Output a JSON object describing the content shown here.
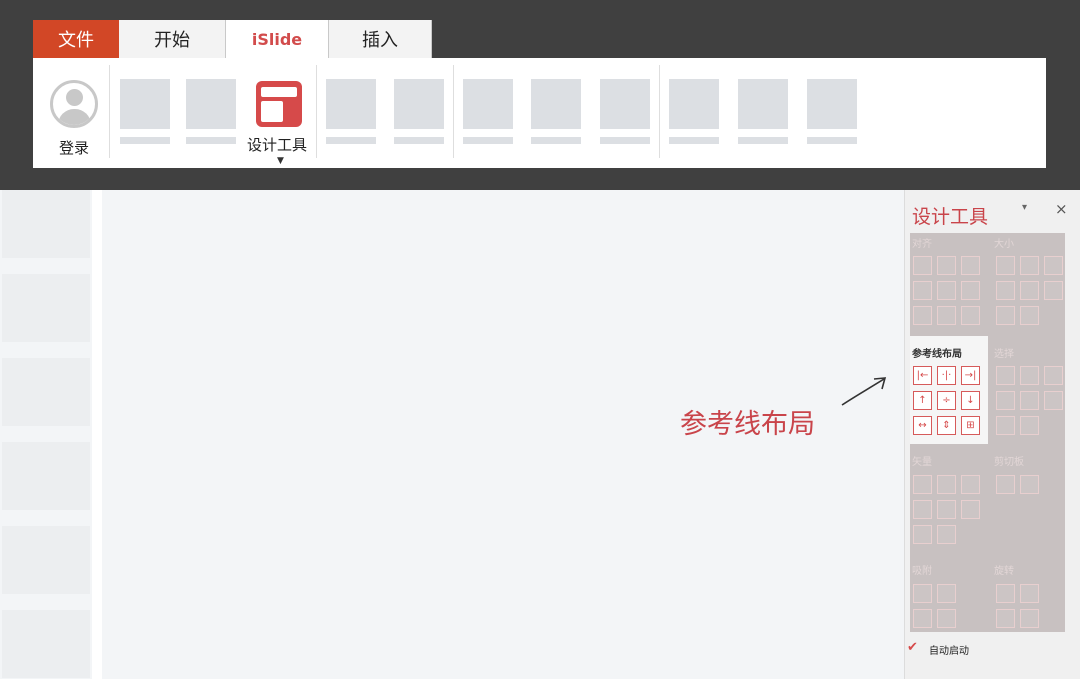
{
  "tabs": [
    {
      "label": "文件"
    },
    {
      "label": "开始"
    },
    {
      "label": "iSlide"
    },
    {
      "label": "插入"
    }
  ],
  "ribbon": {
    "login_label": "登录",
    "design_tools_label": "设计工具",
    "design_tools_caret": "▼"
  },
  "annotation": {
    "text": "参考线布局"
  },
  "panel": {
    "title": "设计工具",
    "pin_glyph": "▾",
    "close_glyph": "×",
    "sections": {
      "align": "对齐",
      "size": "大小",
      "guide_layout": "参考线布局",
      "select": "选择",
      "vector": "矢量",
      "clipboard": "剪切板",
      "snap": "吸附",
      "rotate": "旋转"
    },
    "guide_icons": [
      "|←",
      "·|·",
      "→|",
      "↑",
      "÷",
      "↓",
      "↔",
      "⇕",
      "⊞"
    ],
    "auto_start_label": "自动启动",
    "auto_start_checked": true
  },
  "colors": {
    "accent_red": "#d64a4a",
    "file_tab": "#d24726",
    "chrome": "#404040"
  }
}
